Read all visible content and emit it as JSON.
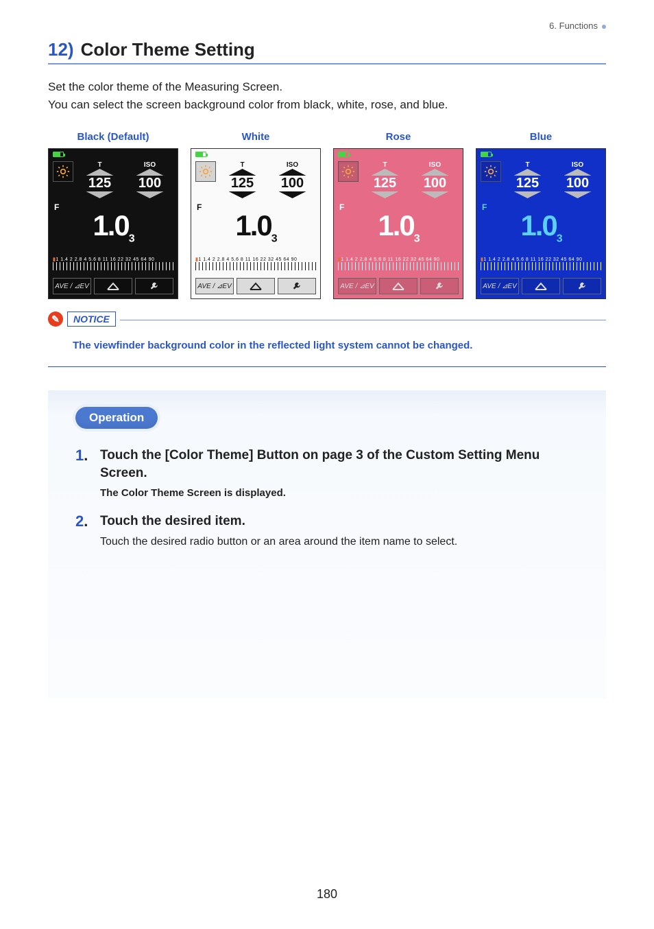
{
  "chapter": "6.  Functions",
  "section_number": "12)",
  "section_title": "Color Theme Setting",
  "lead_line1": "Set the color theme of the Measuring Screen.",
  "lead_line2": "You can select the screen background color from black, white, rose, and blue.",
  "themes": [
    {
      "label": "Black (Default)"
    },
    {
      "label": "White"
    },
    {
      "label": "Rose"
    },
    {
      "label": "Blue"
    }
  ],
  "device": {
    "t_label": "T",
    "iso_label": "ISO",
    "t_value": "125",
    "iso_value": "100",
    "f_label": "F",
    "f_value": "1.0",
    "f_sub": "3",
    "scale_nums": "1 1.4 2 2.8 4 5.6 8 11 16 22 32 45 64 90",
    "btn_ave": "AVE / ⊿EV"
  },
  "notice_label": "NOTICE",
  "notice_text": "The viewfinder background color in the reflected light system cannot be changed.",
  "operation_label": "Operation",
  "steps": [
    {
      "num": "1",
      "head": "Touch the [Color Theme] Button on page 3 of the Custom Setting Menu Screen.",
      "sub": "The Color Theme Screen is displayed."
    },
    {
      "num": "2",
      "head": "Touch the desired item.",
      "desc": "Touch the desired radio button or an area around the item name to select."
    }
  ],
  "page_number": "180"
}
